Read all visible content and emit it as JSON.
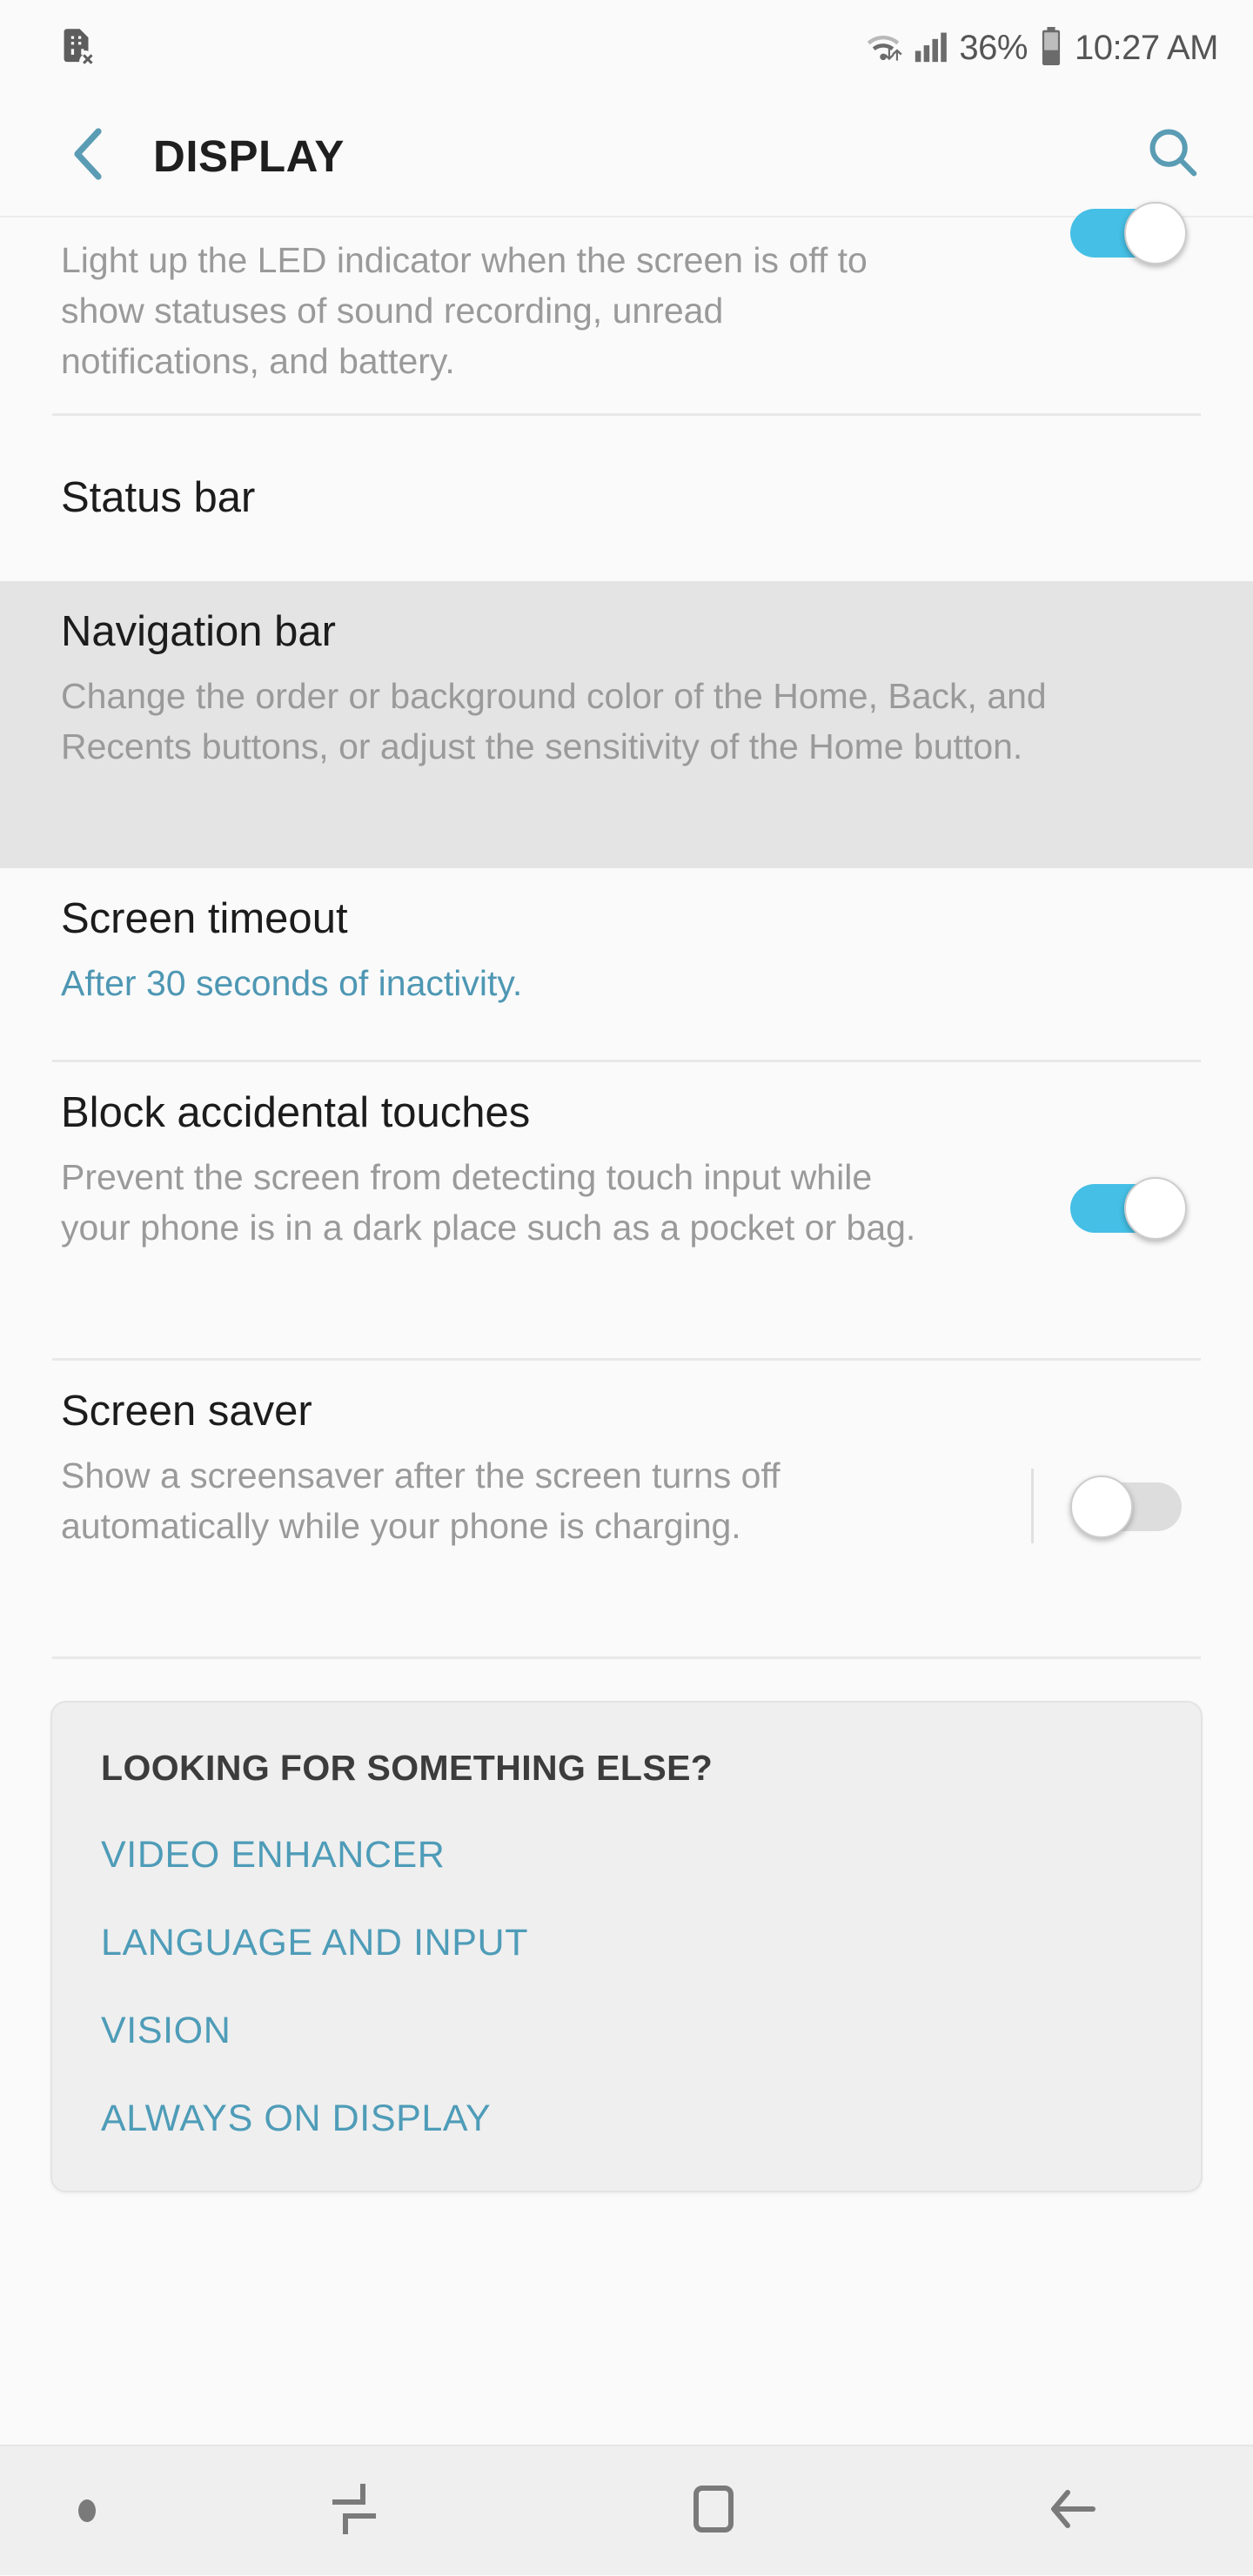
{
  "status_bar": {
    "left_icon": "no-sim-card-icon",
    "wifi_icon": "wifi-data-icon",
    "signal_icon": "cellular-signal-icon",
    "battery_percent": "36%",
    "battery_icon": "battery-icon",
    "time": "10:27 AM"
  },
  "header": {
    "back_icon": "chevron-left-icon",
    "title": "DISPLAY",
    "search_icon": "search-icon"
  },
  "settings": {
    "led_indicator": {
      "subtitle": "Light up the LED indicator when the screen is off to show statuses of sound recording, unread notifications, and battery.",
      "toggle_state": "on"
    },
    "status_bar_row": {
      "title": "Status bar"
    },
    "navigation_bar_row": {
      "title": "Navigation bar",
      "subtitle": "Change the order or background color of the Home, Back, and Recents buttons, or adjust the sensitivity of the Home button.",
      "highlighted": true
    },
    "screen_timeout": {
      "title": "Screen timeout",
      "subtitle": "After 30 seconds of inactivity."
    },
    "block_accidental_touches": {
      "title": "Block accidental touches",
      "subtitle": "Prevent the screen from detecting touch input while your phone is in a dark place such as a pocket or bag.",
      "toggle_state": "on"
    },
    "screen_saver": {
      "title": "Screen saver",
      "subtitle": "Show a screensaver after the screen turns off automatically while your phone is charging.",
      "toggle_state": "off"
    }
  },
  "looking_card": {
    "title": "LOOKING FOR SOMETHING ELSE?",
    "links": [
      "VIDEO ENHANCER",
      "LANGUAGE AND INPUT",
      "VISION",
      "ALWAYS ON DISPLAY"
    ]
  },
  "nav_bar": {
    "hide_icon": "hide-navbar-dot-icon",
    "recents_icon": "recents-icon",
    "home_icon": "home-icon",
    "back_icon": "back-arrow-icon"
  },
  "colors": {
    "accent": "#4e9cb8",
    "toggle_on": "#45bfe5",
    "toggle_off": "#dddddd",
    "highlight_row": "#e4e4e4",
    "page_bg": "#fafafa"
  }
}
